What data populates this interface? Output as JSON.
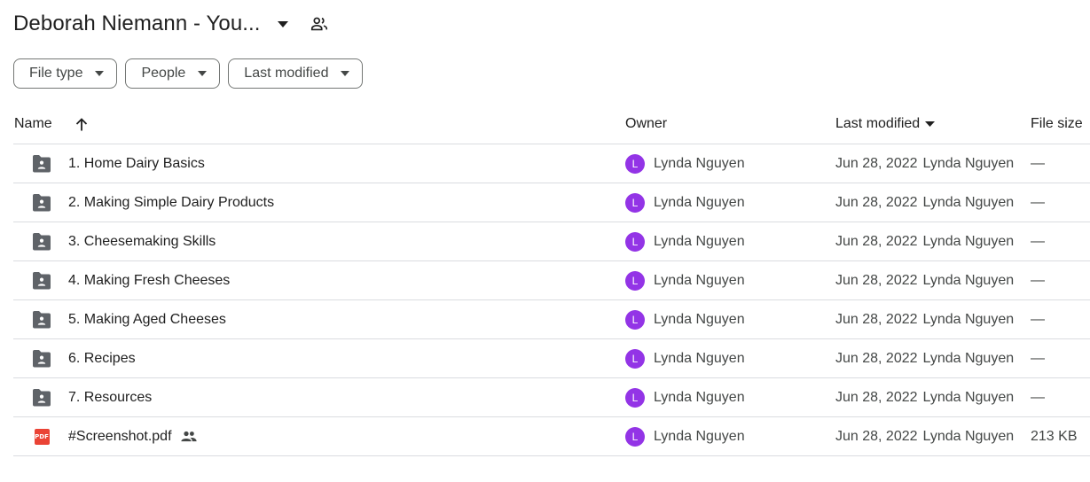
{
  "header": {
    "title": "Deborah Niemann - You...",
    "caret_icon": "arrow-drop-down-icon",
    "shared_icon": "people-outline-icon"
  },
  "filters": [
    {
      "label": "File type"
    },
    {
      "label": "People"
    },
    {
      "label": "Last modified"
    }
  ],
  "columns": {
    "name": "Name",
    "owner": "Owner",
    "last_modified": "Last modified",
    "file_size": "File size",
    "sort_icon": "arrow-upward-icon",
    "sort_dropdown_icon": "arrow-drop-down-icon"
  },
  "colors": {
    "folder": "#5f6368",
    "avatar": "#9334e6",
    "pdf": "#ea4335",
    "divider": "#dadce0"
  },
  "rows": [
    {
      "icon": "shared-folder-icon",
      "name": "1. Home Dairy Basics",
      "owner_initial": "L",
      "owner": "Lynda Nguyen",
      "modified_date": "Jun 28, 2022",
      "modified_by": "Lynda Nguyen",
      "size": "—",
      "shared": false
    },
    {
      "icon": "shared-folder-icon",
      "name": "2. Making Simple Dairy Products",
      "owner_initial": "L",
      "owner": "Lynda Nguyen",
      "modified_date": "Jun 28, 2022",
      "modified_by": "Lynda Nguyen",
      "size": "—",
      "shared": false
    },
    {
      "icon": "shared-folder-icon",
      "name": "3. Cheesemaking Skills",
      "owner_initial": "L",
      "owner": "Lynda Nguyen",
      "modified_date": "Jun 28, 2022",
      "modified_by": "Lynda Nguyen",
      "size": "—",
      "shared": false
    },
    {
      "icon": "shared-folder-icon",
      "name": "4. Making Fresh Cheeses",
      "owner_initial": "L",
      "owner": "Lynda Nguyen",
      "modified_date": "Jun 28, 2022",
      "modified_by": "Lynda Nguyen",
      "size": "—",
      "shared": false
    },
    {
      "icon": "shared-folder-icon",
      "name": "5. Making Aged Cheeses",
      "owner_initial": "L",
      "owner": "Lynda Nguyen",
      "modified_date": "Jun 28, 2022",
      "modified_by": "Lynda Nguyen",
      "size": "—",
      "shared": false
    },
    {
      "icon": "shared-folder-icon",
      "name": "6. Recipes",
      "owner_initial": "L",
      "owner": "Lynda Nguyen",
      "modified_date": "Jun 28, 2022",
      "modified_by": "Lynda Nguyen",
      "size": "—",
      "shared": false
    },
    {
      "icon": "shared-folder-icon",
      "name": "7. Resources",
      "owner_initial": "L",
      "owner": "Lynda Nguyen",
      "modified_date": "Jun 28, 2022",
      "modified_by": "Lynda Nguyen",
      "size": "—",
      "shared": false
    },
    {
      "icon": "pdf-icon",
      "icon_label": "PDF",
      "name": "#Screenshot.pdf",
      "owner_initial": "L",
      "owner": "Lynda Nguyen",
      "modified_date": "Jun 28, 2022",
      "modified_by": "Lynda Nguyen",
      "size": "213 KB",
      "shared": true
    }
  ]
}
